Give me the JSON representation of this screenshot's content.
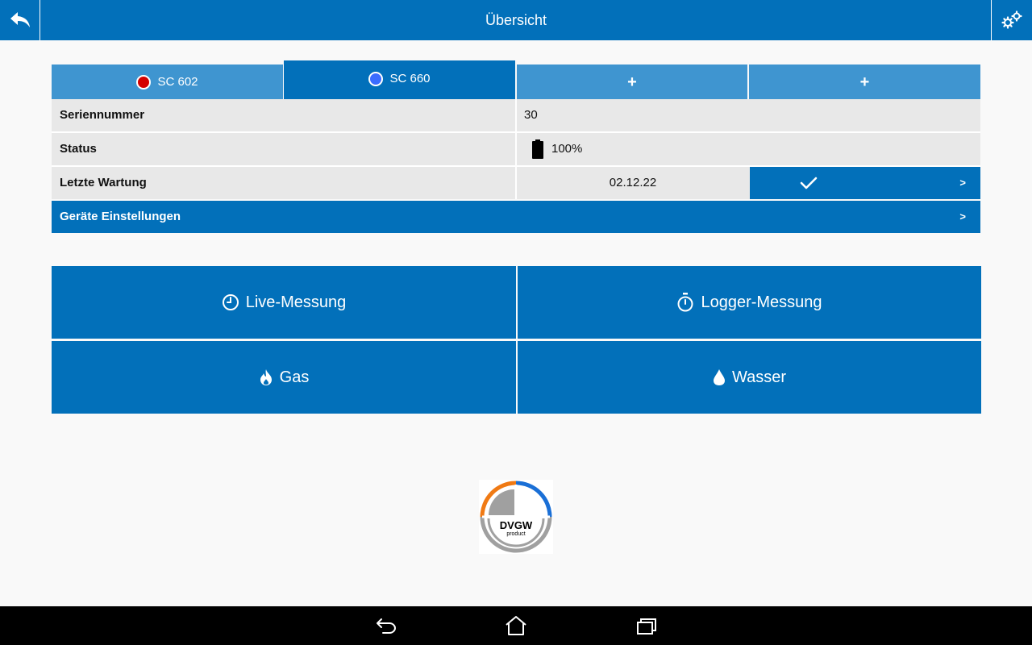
{
  "header": {
    "title": "Übersicht",
    "back_icon": "back-arrow-icon",
    "settings_icon": "gears-icon"
  },
  "tabs": [
    {
      "label": "SC 602",
      "dot_color": "#d40000",
      "active": false
    },
    {
      "label": "SC 660",
      "dot_color": "#3b6cff",
      "active": true
    },
    {
      "label": "+",
      "active": false
    },
    {
      "label": "+",
      "active": false
    }
  ],
  "info": {
    "serial_label": "Seriennummer",
    "serial_value": "30",
    "status_label": "Status",
    "status_value": "100%",
    "maintenance_label": "Letzte Wartung",
    "maintenance_date": "02.12.22",
    "chevron": ">"
  },
  "device_settings": {
    "label": "Geräte Einstellungen",
    "chevron": ">"
  },
  "actions": {
    "live": "Live-Messung",
    "logger": "Logger-Messung",
    "gas": "Gas",
    "water": "Wasser"
  },
  "logo": {
    "text": "DVGW",
    "subtext": "product"
  },
  "colors": {
    "primary": "#0270ba",
    "tab_inactive": "#3f95d0",
    "row_bg": "#e8e8e8",
    "background": "#f9f9f9"
  }
}
